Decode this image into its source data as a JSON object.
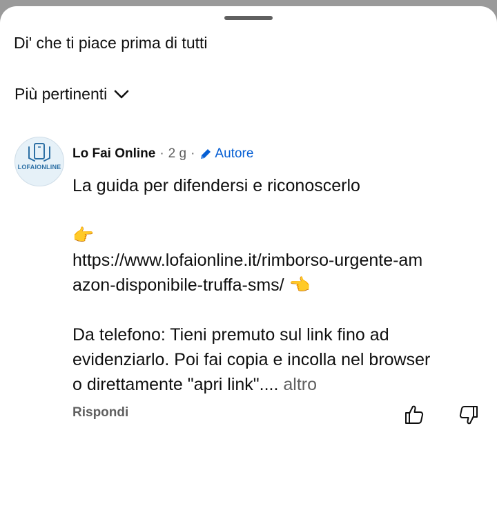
{
  "sheet": {
    "prompt": "Di' che ti piace prima di tutti",
    "sort_label": "Più pertinenti"
  },
  "comment": {
    "author": "Lo Fai Online",
    "avatar_text": "LOFAIONLINE",
    "separator": "·",
    "age": "2 g",
    "badge": "Autore",
    "lines": [
      "La guida per difendersi e riconoscerlo",
      "",
      "👉",
      "https://www.lofaionline.it/rimborso-urgente-am",
      "azon-disponibile-truffa-sms/ 👈",
      "",
      "Da telefono: Tieni premuto sul link fino ad",
      "evidenziarlo. Poi fai copia e incolla nel browser",
      "o direttamente \"apri link\"...."
    ],
    "more_label": "altro",
    "reply_label": "Rispondi"
  },
  "icons": {
    "sort": "chevron-down-icon",
    "badge": "pencil-icon",
    "like": "thumbs-up-icon",
    "dislike": "thumbs-down-icon"
  },
  "colors": {
    "badge": "#065fd4",
    "secondary_text": "#606060",
    "overlay": "#9a9a9a"
  }
}
